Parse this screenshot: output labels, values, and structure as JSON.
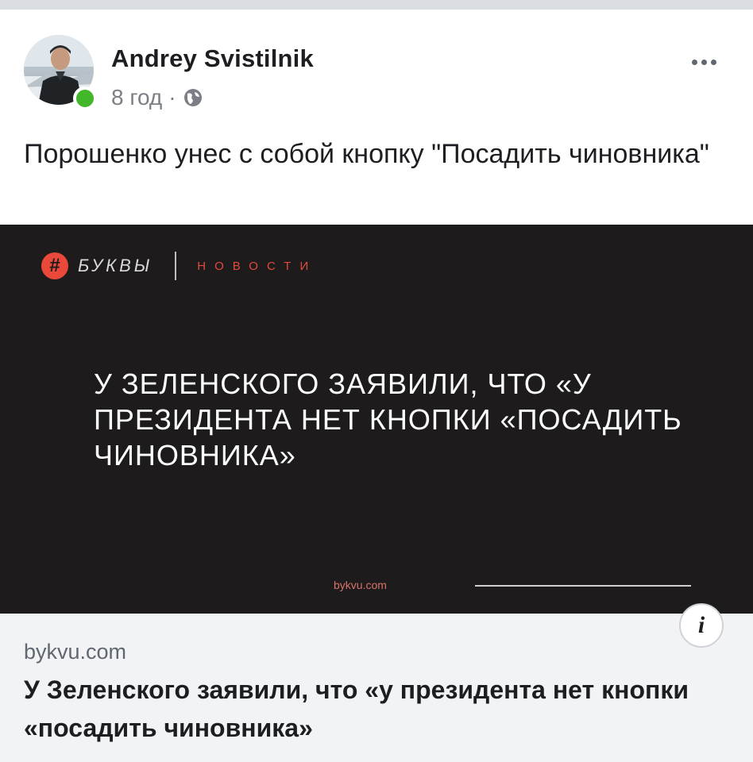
{
  "post": {
    "author": "Andrey Svistilnik",
    "time": "8 год",
    "separator": "·",
    "text": "Порошенко унес с собой кнопку \"Посадить чиновника\"",
    "online_status_color": "#42b72a",
    "icons": {
      "privacy": "globe-icon",
      "more": "more-icon"
    }
  },
  "preview_image": {
    "brand_name": "БУКВЫ",
    "brand_badge": "#",
    "section": "НОВОСТИ",
    "headline": "У ЗЕЛЕНСКОГО ЗАЯВИЛИ, ЧТО «У ПРЕЗИДЕНТА НЕТ КНОПКИ «ПОСАДИТЬ ЧИНОВНИКА»",
    "domain": "bykvu.com",
    "background_color": "#1d1b1c",
    "accent_color": "#e9483a"
  },
  "link_preview": {
    "domain": "bykvu.com",
    "title": "У Зеленского заявили, что «у президента нет кнопки «посадить чиновника»",
    "info_label": "i"
  }
}
